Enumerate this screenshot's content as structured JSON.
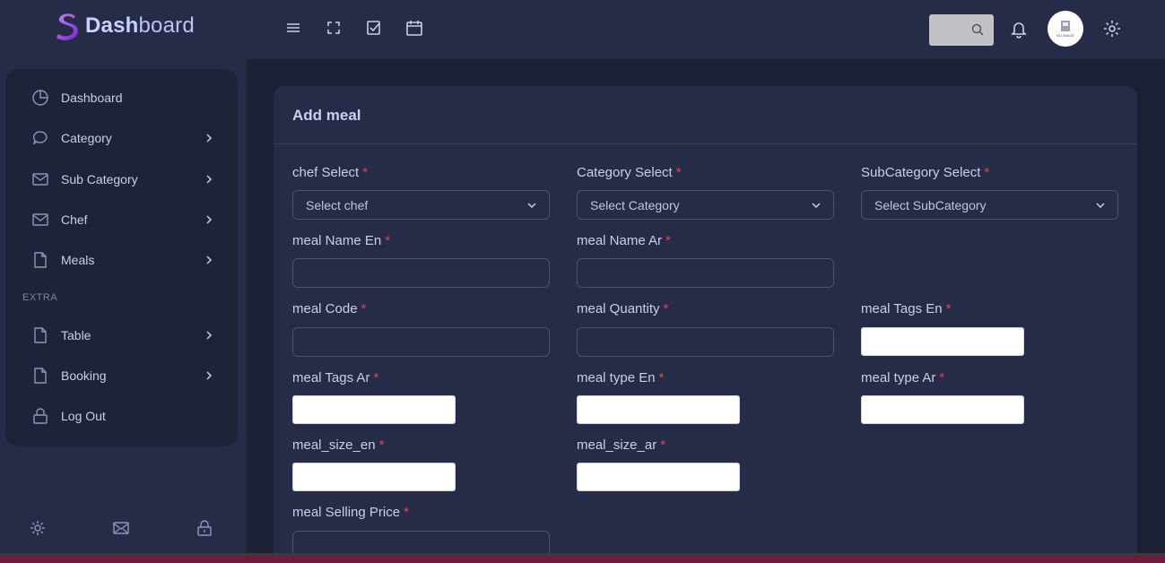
{
  "brand": {
    "bold": "Dash",
    "rest": "board"
  },
  "topbar": {
    "icons": [
      "menu-icon",
      "fullscreen-icon",
      "checkbox-icon",
      "calendar-icon"
    ],
    "search_icon": "search-icon",
    "notification_icon": "bell-icon",
    "avatar_label": "NO IMAGE",
    "settings_icon": "gear-icon"
  },
  "sidebar": {
    "items": [
      {
        "label": "Dashboard",
        "icon": "pie-chart-icon",
        "has_submenu": false
      },
      {
        "label": "Category",
        "icon": "chat-bubble-icon",
        "has_submenu": true
      },
      {
        "label": "Sub Category",
        "icon": "envelope-icon",
        "has_submenu": true
      },
      {
        "label": "Chef",
        "icon": "envelope-icon",
        "has_submenu": true
      },
      {
        "label": "Meals",
        "icon": "file-icon",
        "has_submenu": true
      }
    ],
    "section_label": "EXTRA",
    "extra_items": [
      {
        "label": "Table",
        "icon": "file-icon",
        "has_submenu": true
      },
      {
        "label": "Booking",
        "icon": "file-icon",
        "has_submenu": true
      },
      {
        "label": "Log Out",
        "icon": "lock-icon",
        "has_submenu": false
      }
    ],
    "footer_icons": [
      "gear-icon",
      "envelope-icon",
      "lock-icon"
    ]
  },
  "form": {
    "title": "Add meal",
    "required_mark": "*",
    "chef_label": "chef Select",
    "chef_placeholder": "Select chef",
    "category_label": "Category Select",
    "category_placeholder": "Select Category",
    "subcategory_label": "SubCategory Select",
    "subcategory_placeholder": "Select SubCategory",
    "name_en_label": "meal Name En",
    "name_ar_label": "meal Name Ar",
    "code_label": "meal Code",
    "quantity_label": "meal Quantity",
    "tags_en_label": "meal Tags En",
    "tags_ar_label": "meal Tags Ar",
    "type_en_label": "meal type En",
    "type_ar_label": "meal type Ar",
    "size_en_label": "meal_size_en",
    "size_ar_label": "meal_size_ar",
    "price_label": "meal Selling Price"
  },
  "colors": {
    "accent": "#b9c3f5",
    "required": "#e0414f",
    "logo": "#a855f7"
  }
}
